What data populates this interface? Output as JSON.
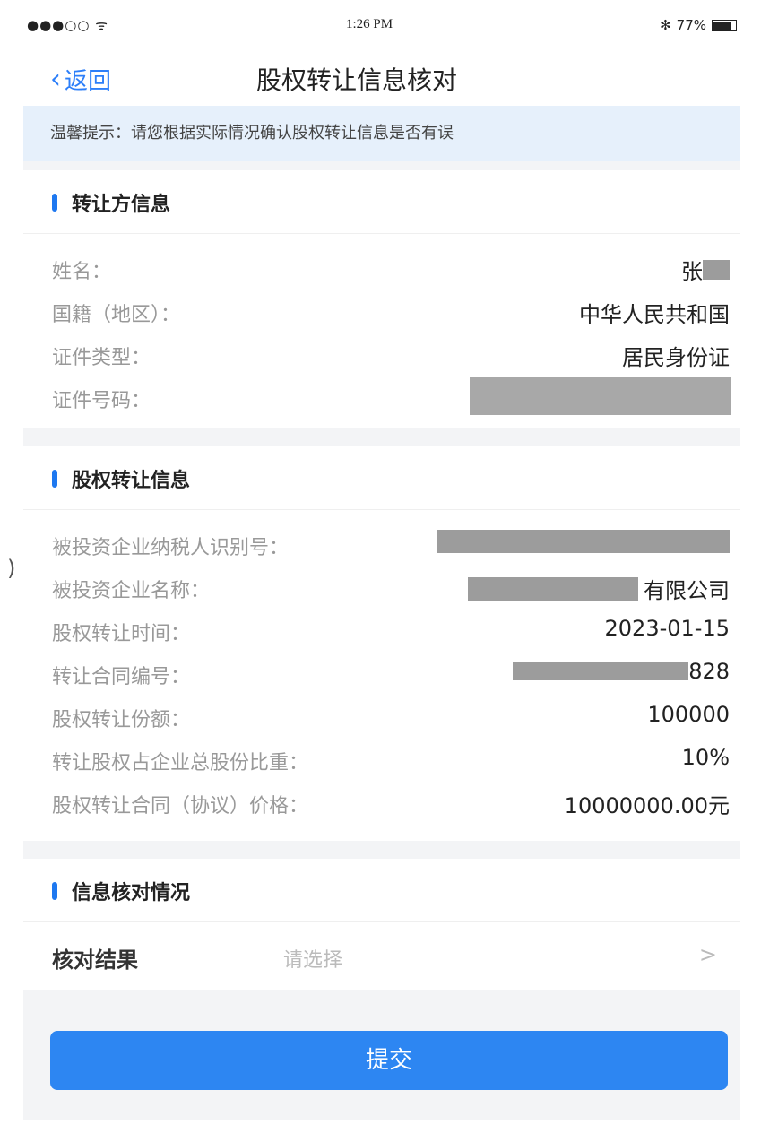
{
  "status_bar": {
    "signal": "●●●○○",
    "wifi": "ᯤ",
    "time": "1:26 PM",
    "bluetooth": "✻",
    "battery": "77%"
  },
  "nav": {
    "back_label": "返回",
    "title": "股权转让信息核对"
  },
  "tip": "温馨提示：请您根据实际情况确认股权转让信息是否有误",
  "transferor": {
    "title": "转让方信息",
    "rows": [
      {
        "label": "姓名：",
        "value": "张"
      },
      {
        "label": "国籍（地区）：",
        "value": "中华人民共和国"
      },
      {
        "label": "证件类型：",
        "value": "居民身份证"
      },
      {
        "label": "证件号码：",
        "value": ""
      }
    ]
  },
  "equity": {
    "title": "股权转让信息",
    "rows": [
      {
        "label": "被投资企业纳税人识别号：",
        "value": ""
      },
      {
        "label": "被投资企业名称：",
        "value": "有限公司"
      },
      {
        "label": "股权转让时间：",
        "value": "2023-01-15"
      },
      {
        "label": "转让合同编号：",
        "value": "828"
      },
      {
        "label": "股权转让份额：",
        "value": "100000"
      },
      {
        "label": "转让股权占企业总股份比重：",
        "value": "10%"
      },
      {
        "label": "股权转让合同（协议）价格：",
        "value": "10000000.00元"
      }
    ]
  },
  "check": {
    "title": "信息核对情况",
    "label": "核对结果",
    "placeholder": "请选择",
    "arrow": ">"
  },
  "submit_label": "提交",
  "edge_mark": ")"
}
